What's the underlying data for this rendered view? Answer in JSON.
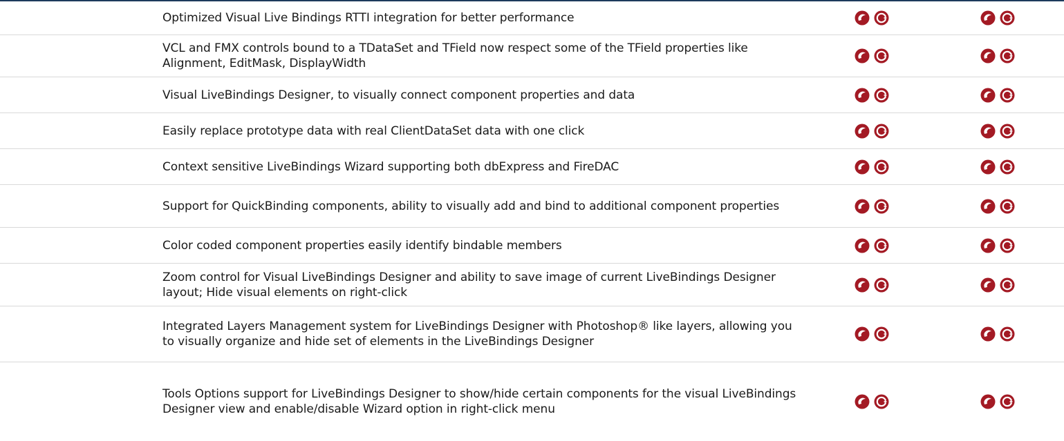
{
  "colors": {
    "icon_fill": "#a31a24",
    "divider": "#d9d9d9",
    "top_rule": "#1d3a5c"
  },
  "icons": {
    "delphi": "delphi-icon",
    "cpp": "cpp-builder-icon"
  },
  "rows": [
    {
      "text": "Optimized Visual Live Bindings RTTI integration for better performance"
    },
    {
      "text": "VCL and FMX controls bound to a TDataSet and TField now respect some of the TField properties like Alignment, EditMask, DisplayWidth"
    },
    {
      "text": "Visual LiveBindings Designer, to visually connect component properties and data"
    },
    {
      "text": "Easily replace prototype data with real ClientDataSet data with one click"
    },
    {
      "text": "Context sensitive LiveBindings Wizard supporting both dbExpress and FireDAC"
    },
    {
      "text": "Support for QuickBinding components, ability to visually add and bind to additional component properties"
    },
    {
      "text": "Color coded component properties easily identify bindable members"
    },
    {
      "text": "Zoom control for Visual LiveBindings Designer and ability to save image of current LiveBindings Designer layout; Hide visual elements on right-click"
    },
    {
      "text": "Integrated Layers Management system for LiveBindings Designer with Photoshop® like layers, allowing you to visually organize and hide set of elements in the LiveBindings Designer"
    },
    {
      "text": "Tools Options support for LiveBindings Designer to show/hide certain components for the visual LiveBindings Designer view and enable/disable Wizard option in right-click menu"
    }
  ]
}
